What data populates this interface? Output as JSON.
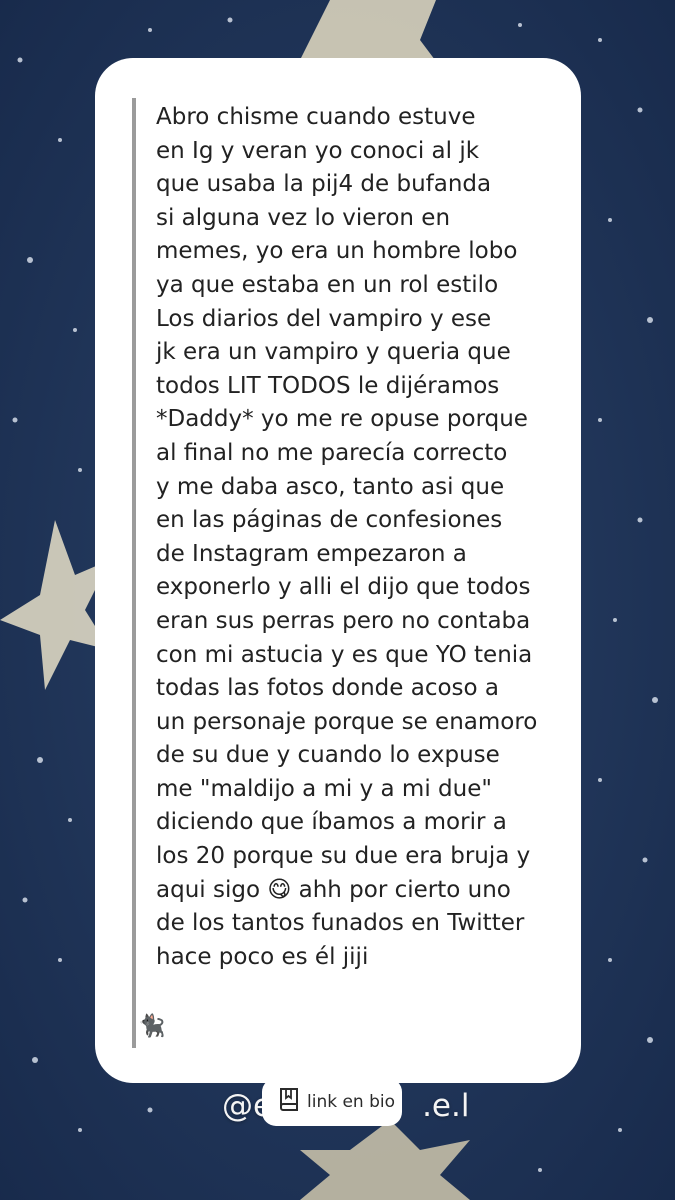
{
  "message": {
    "lines": [
      "Abro chisme cuando estuve",
      "en Ig y veran yo conoci al jk",
      "que usaba la pij4 de bufanda",
      "si alguna vez lo vieron en",
      "memes, yo era un hombre lobo",
      "ya que estaba en un rol estilo",
      "Los diarios del vampiro y ese",
      "jk era un vampiro y queria que",
      "todos LIT TODOS le dijéramos",
      "*Daddy* yo me re opuse porque",
      "al final no me parecía correcto",
      "y me daba asco, tanto asi que",
      "en las páginas de confesiones",
      "de Instagram empezaron a",
      "exponerlo y alli el dijo que todos",
      "eran sus perras pero no contaba",
      "con mi astucia y es que YO tenia",
      "todas las fotos donde acoso a",
      "un personaje porque se enamoro",
      "de su due y cuando lo expuse",
      "me \"maldijo a mi y a mi due\"",
      "diciendo que íbamos a morir a",
      "los 20 porque su due era bruja y",
      "aqui sigo 😋 ahh por cierto uno",
      "de los tantos funados en Twitter",
      "hace poco es él jiji"
    ],
    "signoff_emoji": "🐈‍⬛"
  },
  "handle": {
    "visible_left": "@e",
    "visible_right": ".e.l"
  },
  "sticker": {
    "label": "link en bio",
    "icon": "book-icon"
  },
  "colors": {
    "background": "#1e3352",
    "card": "#ffffff",
    "quote_bar": "#9b9b9b",
    "text": "#222222"
  }
}
